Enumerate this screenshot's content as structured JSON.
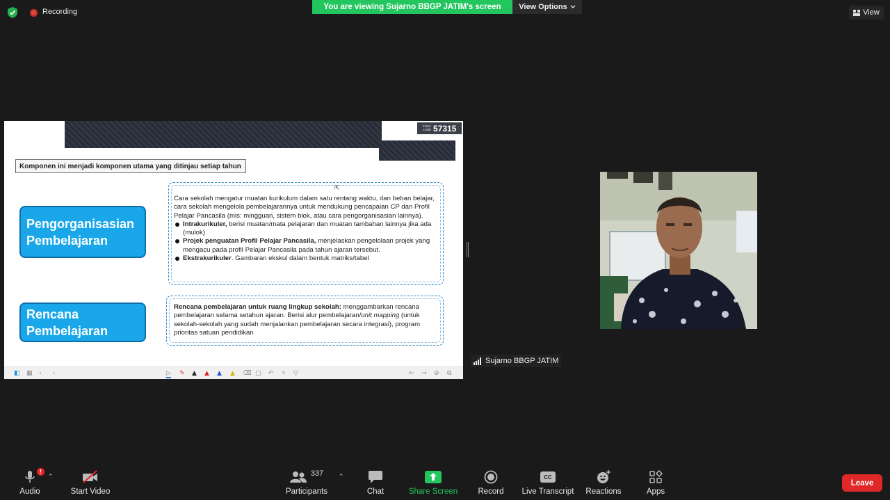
{
  "top_bar": {
    "recording_label": "Recording",
    "viewing_banner": "You are viewing Sujarno BBGP JATIM's screen",
    "view_options_label": "View Options",
    "view_label": "View"
  },
  "slide": {
    "class_code_label_1": "class",
    "class_code_label_2": "code",
    "class_code": "57315",
    "note": "Komponen ini menjadi komponen utama yang ditinjau setiap tahun",
    "section1_title_line1": "Pengorganisasian",
    "section1_title_line2": "Pembelajaran",
    "section1_intro": "Cara sekolah mengatur muatan kurikulum dalam satu rentang waktu, dan beban belajar,  cara sekolah mengelola pembelajarannya untuk mendukung pencapaian CP dan Profil Pelajar Pancasila (mis: mingguan, sistem blok, atau cara pengorganisasian lainnya).",
    "bullets": [
      {
        "bold": "Intrakurikuler,",
        "text": " berisi  muatan/mata pelajaran dan muatan tambahan lainnya jika ada (mulok)"
      },
      {
        "bold": "Projek penguatan Profil Pelajar Pancasila,",
        "text": " menjelaskan pengelolaan projek yang mengacu pada profil Pelajar Pancasila pada tahun ajaran tersebut."
      },
      {
        "bold": "Ekstrakurikuler",
        "text": ". Gambaran ekskul dalam bentuk matriks/tabel"
      }
    ],
    "section2_title_line1": "Rencana",
    "section2_title_line2": "Pembelajaran",
    "section2_bold": "Rencana pembelajaran untuk ruang lingkup sekolah:",
    "section2_text_a": " menggambarkan rencana pembelajaran selama setahun ajaran. Berisi alur pembelajaran/",
    "section2_italic": "unit mapping",
    "section2_text_b": " (untuk sekolah-sekolah yang sudah menjalankan pembelajaran secara integrasi), program prioritas satuan pendidikan"
  },
  "participant": {
    "name": "Sujarno BBGP JATIM"
  },
  "toolbar": {
    "audio": "Audio",
    "audio_badge": "!",
    "start_video": "Start Video",
    "participants": "Participants",
    "participants_count": "337",
    "chat": "Chat",
    "share_screen": "Share Screen",
    "record": "Record",
    "live_transcript": "Live Transcript",
    "cc_icon_text": "CC",
    "reactions": "Reactions",
    "apps": "Apps",
    "leave": "Leave"
  },
  "colors": {
    "banner_green": "#23c55e",
    "leave_red": "#e02828",
    "slide_title_blue": "#1aa7ea",
    "share_green": "#23c55e"
  }
}
